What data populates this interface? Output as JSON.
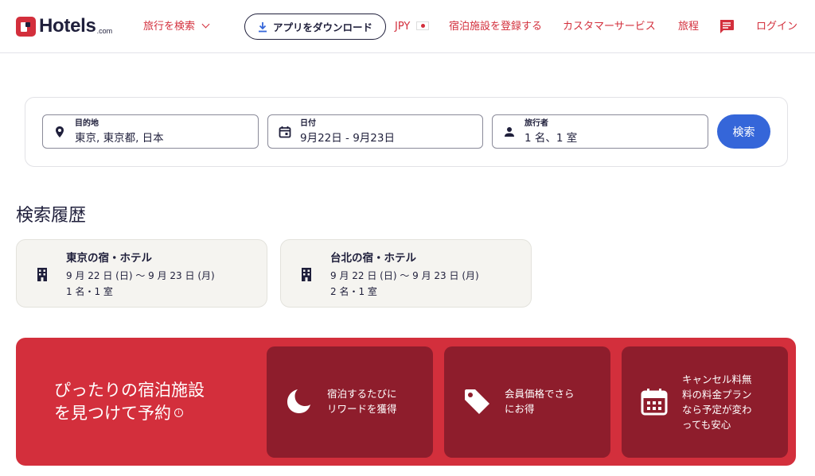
{
  "header": {
    "logo_text": "Hotels",
    "logo_suffix": ".com",
    "explore_label": "旅行を検索",
    "app_download_label": "アプリをダウンロード",
    "currency_label": "JPY",
    "list_property_label": "宿泊施設を登録する",
    "customer_service_label": "カスタマーサービス",
    "trips_label": "旅程",
    "login_label": "ログイン"
  },
  "search": {
    "destination": {
      "label": "目的地",
      "value": "東京, 東京都, 日本"
    },
    "dates": {
      "label": "日付",
      "value": "9月22日 - 9月23日"
    },
    "travelers": {
      "label": "旅行者",
      "value": "1 名、1 室"
    },
    "button_label": "検索"
  },
  "history": {
    "title": "検索履歴",
    "items": [
      {
        "title": "東京の宿・ホテル",
        "dates": "9 月 22 日 (日) 〜 9 月 23 日 (月)",
        "guests": "1 名・1 室"
      },
      {
        "title": "台北の宿・ホテル",
        "dates": "9 月 22 日 (日) 〜 9 月 23 日 (月)",
        "guests": "2 名・1 室"
      }
    ]
  },
  "promo": {
    "title_line1": "ぴったりの宿泊施設",
    "title_line2": "を見つけて予約",
    "info_symbol": "i",
    "perks": [
      {
        "icon": "moon-icon",
        "line1": "宿泊するたびに",
        "line2": "リワードを獲得"
      },
      {
        "icon": "price-tag-icon",
        "line1": "会員価格でさら",
        "line2": "にお得"
      },
      {
        "icon": "calendar-icon",
        "line1": "キャンセル料無",
        "line2": "料の料金プラン",
        "line3": "なら予定が変わ",
        "line4": "っても安心"
      }
    ]
  },
  "colors": {
    "brand_red": "#d32f3c",
    "promo_card": "#8e1d2c",
    "search_button": "#3566d9",
    "text_dark": "#1f1f3b",
    "history_card": "#f5f4f0"
  }
}
